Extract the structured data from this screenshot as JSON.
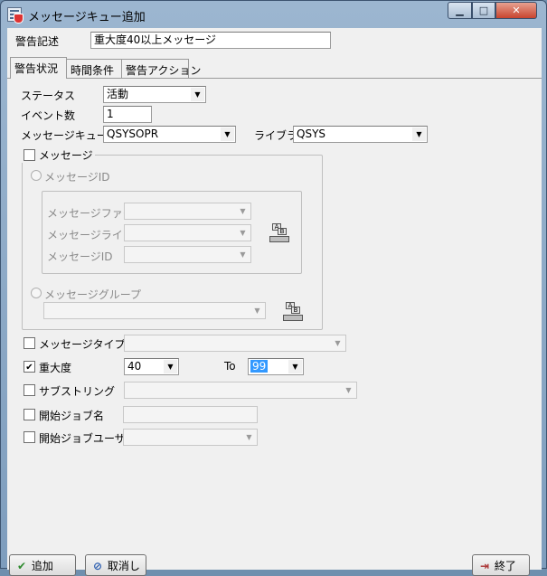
{
  "window": {
    "title": "メッセージキュー追加",
    "min_label": "▁",
    "max_label": "□",
    "close_label": "✕"
  },
  "header": {
    "description_label": "警告記述",
    "description_value": "重大度40以上メッセージ"
  },
  "tabs": [
    {
      "label": "警告状況",
      "active": true
    },
    {
      "label": "時間条件",
      "active": false
    },
    {
      "label": "警告アクション",
      "active": false
    }
  ],
  "form": {
    "status_label": "ステータス",
    "status_value": "活動",
    "event_count_label": "イベント数",
    "event_count_value": "1",
    "queue_label": "メッセージキュー",
    "queue_value": "QSYSOPR",
    "library_label": "ライブラリ",
    "library_value": "QSYS"
  },
  "message_group": {
    "caption": "メッセージ",
    "checked": false,
    "message_id_radio": "メッセージID",
    "file_label": "メッセージファイル",
    "file_value": "",
    "msg_library_label": "メッセージライブラリ",
    "msg_library_value": "",
    "id_label": "メッセージID",
    "id_value": "",
    "group_radio": "メッセージグループ",
    "group_value": ""
  },
  "filters": {
    "msg_type_label": "メッセージタイプ",
    "msg_type_checked": false,
    "msg_type_value": "",
    "severity_label": "重大度",
    "severity_checked": true,
    "severity_from": "40",
    "to_label": "To",
    "severity_to": "99",
    "substring_label": "サブストリング",
    "substring_checked": false,
    "substring_value": "",
    "job_name_label": "開始ジョブ名",
    "job_name_checked": false,
    "job_name_value": "",
    "job_user_label": "開始ジョブユーザー",
    "job_user_checked": false,
    "job_user_value": ""
  },
  "buttons": {
    "add": "追加",
    "cancel": "取消し",
    "close": "終了"
  },
  "icons": {
    "dropdown": "▼",
    "library_browse_icon": "book-stack-icon"
  }
}
